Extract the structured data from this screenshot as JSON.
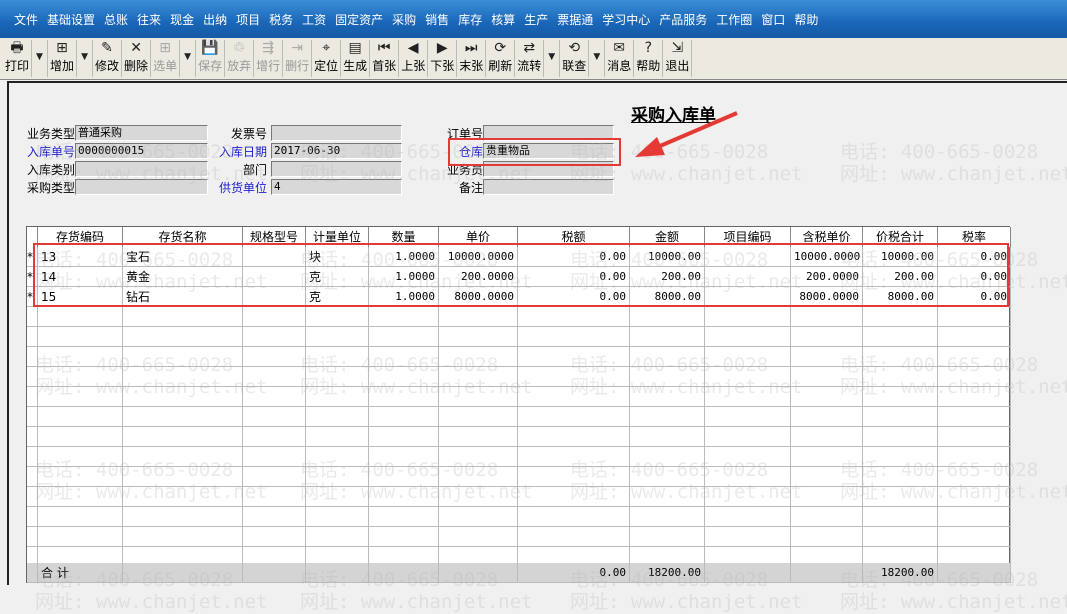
{
  "menu": [
    "文件",
    "基础设置",
    "总账",
    "往来",
    "现金",
    "出纳",
    "项目",
    "税务",
    "工资",
    "固定资产",
    "采购",
    "销售",
    "库存",
    "核算",
    "生产",
    "票据通",
    "学习中心",
    "产品服务",
    "工作圈",
    "窗口",
    "帮助"
  ],
  "toolbar": [
    {
      "label": "打印",
      "icon": "printer-icon",
      "ch": "🖶",
      "enabled": true
    },
    {
      "label": "",
      "icon": "dropdown-icon",
      "ch": "▼",
      "enabled": true,
      "dd": true
    },
    {
      "label": "增加",
      "icon": "add-icon",
      "ch": "⊞",
      "enabled": true
    },
    {
      "label": "",
      "icon": "dropdown-icon",
      "ch": "▼",
      "enabled": true,
      "dd": true
    },
    {
      "label": "修改",
      "icon": "edit-icon",
      "ch": "✎",
      "enabled": true
    },
    {
      "label": "删除",
      "icon": "delete-icon",
      "ch": "✕",
      "enabled": true
    },
    {
      "label": "选单",
      "icon": "select-icon",
      "ch": "⊞",
      "enabled": false
    },
    {
      "label": "",
      "icon": "dropdown-icon",
      "ch": "▼",
      "enabled": true,
      "dd": true
    },
    {
      "label": "保存",
      "icon": "save-icon",
      "ch": "💾",
      "enabled": false
    },
    {
      "label": "放弃",
      "icon": "discard-icon",
      "ch": "♲",
      "enabled": false
    },
    {
      "label": "增行",
      "icon": "add-row-icon",
      "ch": "⇶",
      "enabled": false
    },
    {
      "label": "删行",
      "icon": "delete-row-icon",
      "ch": "⇥",
      "enabled": false
    },
    {
      "label": "定位",
      "icon": "locate-icon",
      "ch": "⌖",
      "enabled": true
    },
    {
      "label": "生成",
      "icon": "generate-icon",
      "ch": "▤",
      "enabled": true
    },
    {
      "label": "首张",
      "icon": "first-icon",
      "ch": "⏮",
      "enabled": true
    },
    {
      "label": "上张",
      "icon": "prev-icon",
      "ch": "◀",
      "enabled": true
    },
    {
      "label": "下张",
      "icon": "next-icon",
      "ch": "▶",
      "enabled": true
    },
    {
      "label": "末张",
      "icon": "last-icon",
      "ch": "⏭",
      "enabled": true
    },
    {
      "label": "刷新",
      "icon": "refresh-icon",
      "ch": "⟳",
      "enabled": true
    },
    {
      "label": "流转",
      "icon": "flow-icon",
      "ch": "⇄",
      "enabled": true
    },
    {
      "label": "",
      "icon": "dropdown-icon",
      "ch": "▼",
      "enabled": true,
      "dd": true
    },
    {
      "label": "联查",
      "icon": "query-icon",
      "ch": "⟲",
      "enabled": true
    },
    {
      "label": "",
      "icon": "dropdown-icon",
      "ch": "▼",
      "enabled": true,
      "dd": true
    },
    {
      "label": "消息",
      "icon": "message-icon",
      "ch": "✉",
      "enabled": true
    },
    {
      "label": "帮助",
      "icon": "help-icon",
      "ch": "?",
      "enabled": true
    },
    {
      "label": "退出",
      "icon": "exit-icon",
      "ch": "⇲",
      "enabled": true
    }
  ],
  "form": {
    "title": "采购入库单",
    "fields": [
      {
        "label": "业务类型",
        "value": "普通采购",
        "blue": false
      },
      {
        "label": "入库单号",
        "value": "0000000015",
        "blue": true
      },
      {
        "label": "入库类别",
        "value": "",
        "blue": false
      },
      {
        "label": "采购类型",
        "value": "",
        "blue": false
      },
      {
        "label": "发票号",
        "value": "",
        "blue": false
      },
      {
        "label": "入库日期",
        "value": "2017-06-30",
        "blue": true
      },
      {
        "label": "部门",
        "value": "",
        "blue": false
      },
      {
        "label": "供货单位",
        "value": "4",
        "blue": true
      },
      {
        "label": "订单号",
        "value": "",
        "blue": false
      },
      {
        "label": "仓库",
        "value": "贵重物品",
        "blue": true
      },
      {
        "label": "业务员",
        "value": "",
        "blue": false
      },
      {
        "label": "备注",
        "value": "",
        "blue": false
      }
    ]
  },
  "table": {
    "columns": [
      "",
      "存货编码",
      "存货名称",
      "规格型号",
      "计量单位",
      "数量",
      "单价",
      "税额",
      "金额",
      "项目编码",
      "含税单价",
      "价税合计",
      "税率"
    ],
    "rows": [
      [
        "*",
        "13",
        "宝石",
        "",
        "块",
        "1.0000",
        "10000.0000",
        "0.00",
        "10000.00",
        "",
        "10000.0000",
        "10000.00",
        "0.00"
      ],
      [
        "*",
        "14",
        "黄金",
        "",
        "克",
        "1.0000",
        "200.0000",
        "0.00",
        "200.00",
        "",
        "200.0000",
        "200.00",
        "0.00"
      ],
      [
        "*",
        "15",
        "钻石",
        "",
        "克",
        "1.0000",
        "8000.0000",
        "0.00",
        "8000.00",
        "",
        "8000.0000",
        "8000.00",
        "0.00"
      ]
    ],
    "total": [
      "",
      "合 计",
      "",
      "",
      "",
      "",
      "",
      "0.00",
      "18200.00",
      "",
      "",
      "18200.00",
      ""
    ]
  },
  "watermark": [
    "电话: 400-665-0028",
    "网址: www.chanjet.net"
  ],
  "annotation_color": "#e53935"
}
